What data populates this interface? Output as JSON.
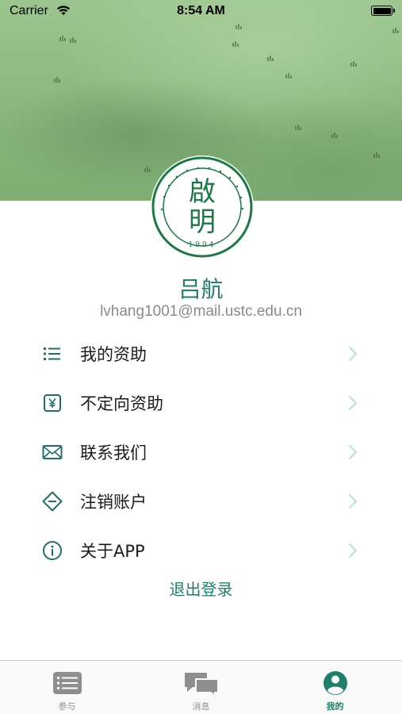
{
  "status_bar": {
    "carrier": "Carrier",
    "time": "8:54 AM",
    "icons": [
      "wifi-icon",
      "battery-icon"
    ]
  },
  "logo": {
    "seal_top": "啟",
    "seal_bottom": "明",
    "year": "1994"
  },
  "profile": {
    "name": "吕航",
    "email": "lvhang1001@mail.ustc.edu.cn"
  },
  "menu": {
    "items": [
      {
        "label": "我的资助",
        "icon": "list-icon"
      },
      {
        "label": "不定向资助",
        "icon": "yen-icon"
      },
      {
        "label": "联系我们",
        "icon": "mail-icon"
      },
      {
        "label": "注销账户",
        "icon": "minus-diamond-icon"
      },
      {
        "label": "关于APP",
        "icon": "info-icon"
      }
    ]
  },
  "logout_label": "退出登录",
  "tabs": [
    {
      "label": "参与",
      "icon": "list-card-icon",
      "active": false
    },
    {
      "label": "消息",
      "icon": "chat-bubbles-icon",
      "active": false
    },
    {
      "label": "我的",
      "icon": "person-icon",
      "active": true
    }
  ],
  "colors": {
    "accent": "#1f7f6a",
    "icon_teal": "#1f6f6a",
    "chevron": "#bfe6dc",
    "tab_inactive": "#8e8e8e",
    "header_green": "#8cba80"
  }
}
